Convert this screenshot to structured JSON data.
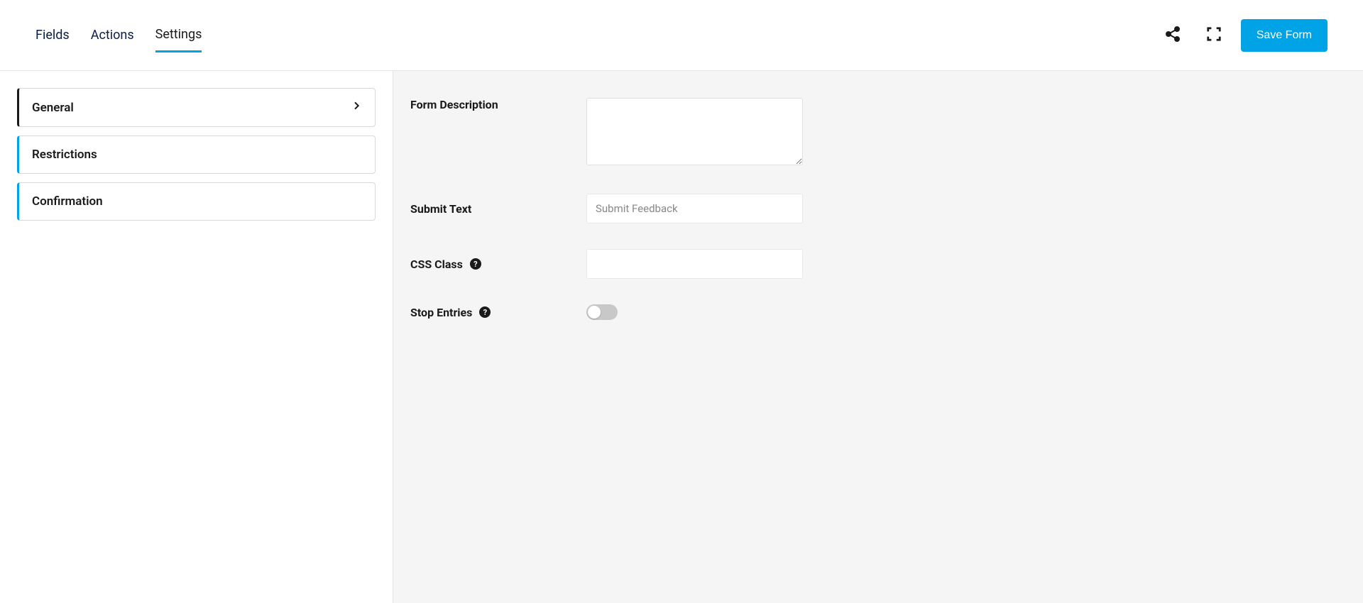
{
  "header": {
    "tabs": [
      {
        "label": "Fields"
      },
      {
        "label": "Actions"
      },
      {
        "label": "Settings"
      }
    ],
    "save_label": "Save Form"
  },
  "sidebar": {
    "items": [
      {
        "label": "General"
      },
      {
        "label": "Restrictions"
      },
      {
        "label": "Confirmation"
      }
    ]
  },
  "settings": {
    "form_description": {
      "label": "Form Description",
      "value": ""
    },
    "submit_text": {
      "label": "Submit Text",
      "placeholder": "Submit Feedback",
      "value": ""
    },
    "css_class": {
      "label": "CSS Class",
      "value": ""
    },
    "stop_entries": {
      "label": "Stop Entries",
      "value": false
    }
  }
}
